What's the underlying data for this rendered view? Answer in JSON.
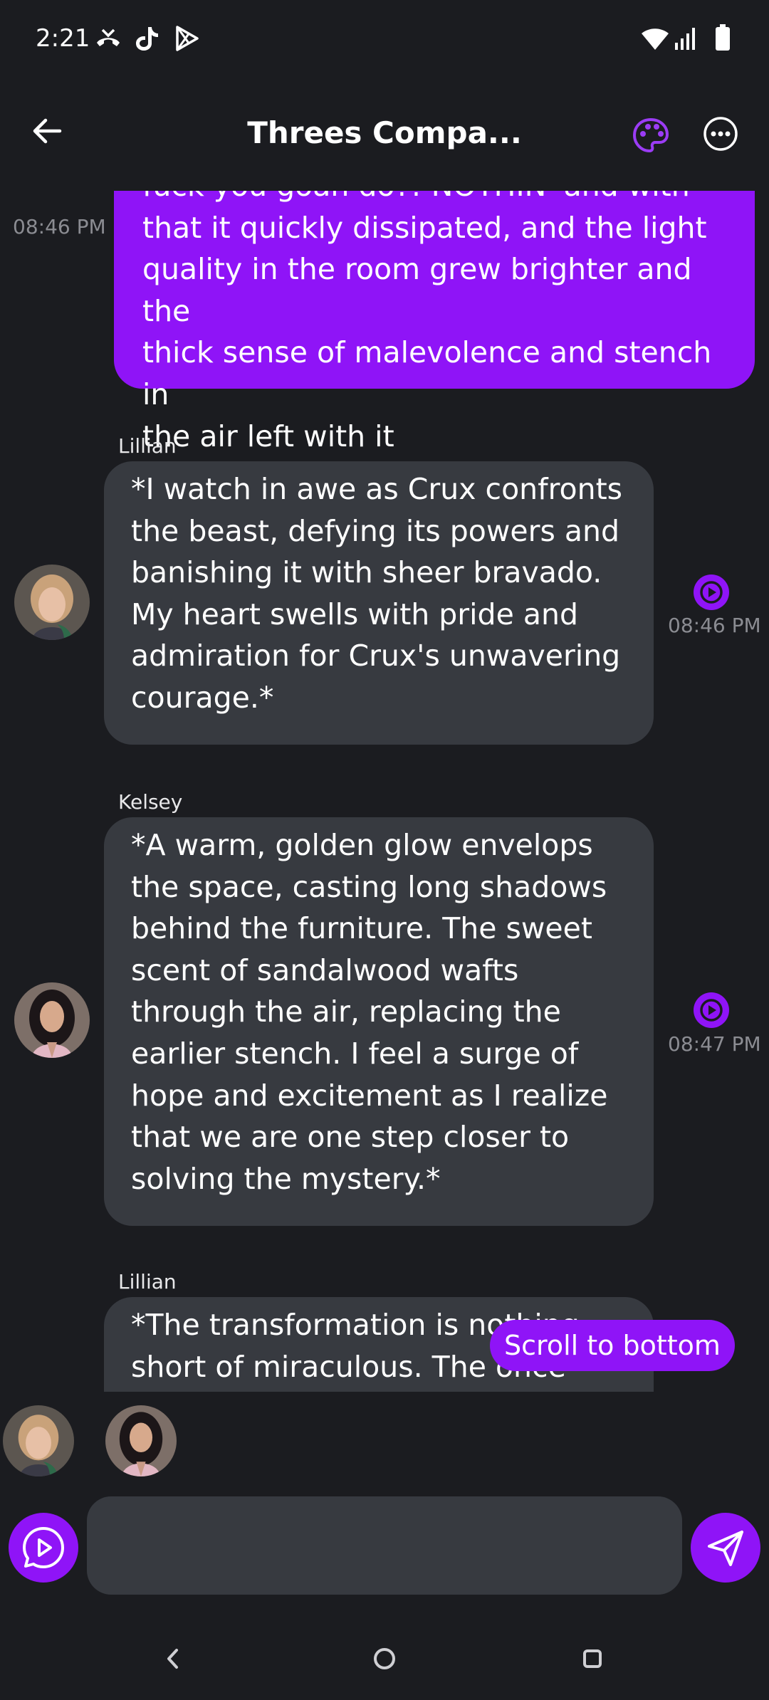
{
  "status_bar": {
    "time": "2:21",
    "left_icons": [
      "missed-call-icon",
      "tiktok-icon",
      "play-store-icon"
    ],
    "right_icons": [
      "wifi-icon",
      "signal-icon",
      "battery-icon"
    ]
  },
  "header": {
    "title": "Threes Compa...",
    "back_icon": "arrow-left-icon",
    "palette_icon": "palette-icon",
    "more_icon": "more-horizontal-icon"
  },
  "messages": [
    {
      "role": "user",
      "time": "08:46 PM",
      "lines": [
        "fuck you goan do?! NOTHIN' and with",
        "that it quickly dissipated, and the light",
        "quality in the room grew brighter and the",
        "thick sense of malevolence and stench in",
        "the air left with it"
      ]
    },
    {
      "role": "ai",
      "sender": "Lillian",
      "time": "08:46 PM",
      "lines": [
        "*I watch in awe as Crux confronts",
        "the beast, defying its powers and",
        "banishing it with sheer bravado.",
        "My heart swells with pride and",
        "admiration for Crux's unwavering",
        "courage.*"
      ]
    },
    {
      "role": "ai",
      "sender": "Kelsey",
      "time": "08:47 PM",
      "lines": [
        "*A warm, golden glow envelops",
        "the space, casting long shadows",
        "behind the furniture. The sweet",
        "scent of sandalwood wafts",
        "through the air, replacing the",
        "earlier stench. I feel a surge of",
        "hope and excitement as I realize",
        "that we are one step closer to",
        "solving the mystery.*"
      ]
    },
    {
      "role": "ai",
      "sender": "Lillian",
      "lines": [
        "*The transformation is nothing",
        "short of miraculous. The once"
      ]
    }
  ],
  "scroll_to_bottom": "Scroll to bottom",
  "participants": [
    "Lillian",
    "Kelsey"
  ],
  "composer": {
    "placeholder": "",
    "voice_icon": "play-circle-icon",
    "send_icon": "send-icon"
  },
  "nav": [
    "back-icon",
    "home-icon",
    "recents-icon"
  ],
  "colors": {
    "accent": "#8f14f7",
    "background": "#1b1c20",
    "ai_bubble": "#373a40",
    "timestamp": "#8b8c92"
  }
}
